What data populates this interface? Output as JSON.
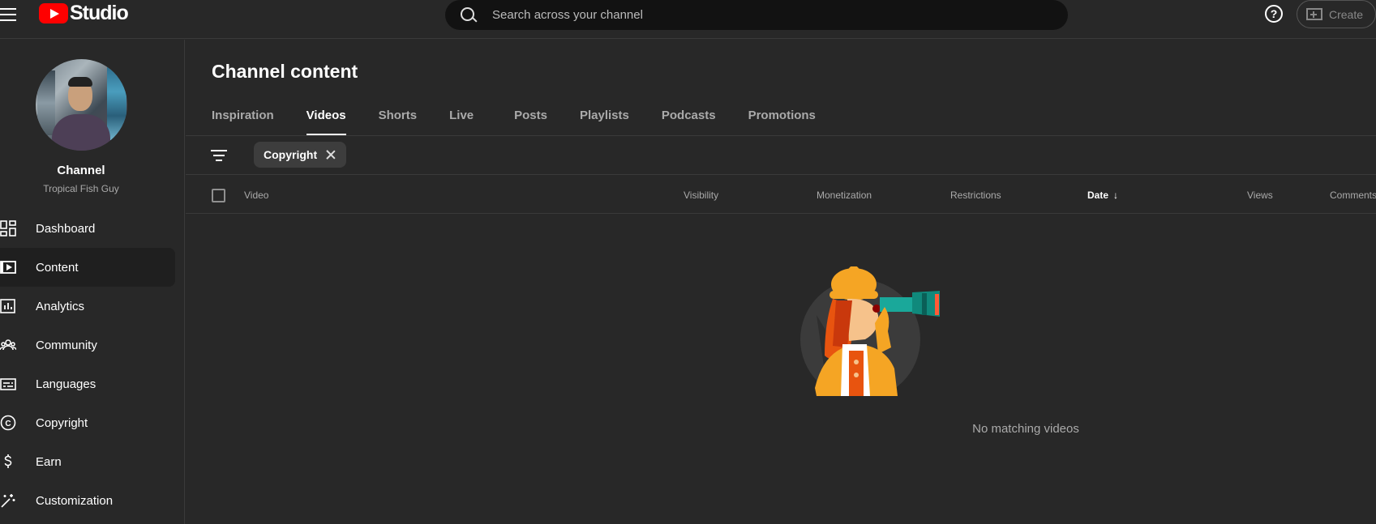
{
  "header": {
    "logo_text": "Studio",
    "search_placeholder": "Search across your channel",
    "help_icon": "?",
    "create_label": "Create"
  },
  "sidebar": {
    "channel_label": "Channel",
    "channel_name": "Tropical Fish Guy",
    "items": [
      {
        "label": "Dashboard",
        "icon": "dashboard-icon"
      },
      {
        "label": "Content",
        "icon": "content-icon",
        "active": true
      },
      {
        "label": "Analytics",
        "icon": "analytics-icon"
      },
      {
        "label": "Community",
        "icon": "community-icon"
      },
      {
        "label": "Languages",
        "icon": "languages-icon"
      },
      {
        "label": "Copyright",
        "icon": "copyright-icon"
      },
      {
        "label": "Earn",
        "icon": "earn-icon"
      },
      {
        "label": "Customization",
        "icon": "customization-icon"
      }
    ]
  },
  "main": {
    "title": "Channel content",
    "tabs": [
      "Inspiration",
      "Videos",
      "Shorts",
      "Live",
      "Posts",
      "Playlists",
      "Podcasts",
      "Promotions"
    ],
    "active_tab": "Videos",
    "filter_chip": "Copyright",
    "columns": {
      "video": "Video",
      "visibility": "Visibility",
      "monetization": "Monetization",
      "restrictions": "Restrictions",
      "date": "Date",
      "date_sort": "↓",
      "views": "Views",
      "comments": "Comments"
    },
    "empty_message": "No matching videos"
  },
  "colors": {
    "background": "#282828",
    "brand_red": "#ff0000",
    "illustration_orange": "#f5a524",
    "illustration_teal": "#1aa89a"
  }
}
